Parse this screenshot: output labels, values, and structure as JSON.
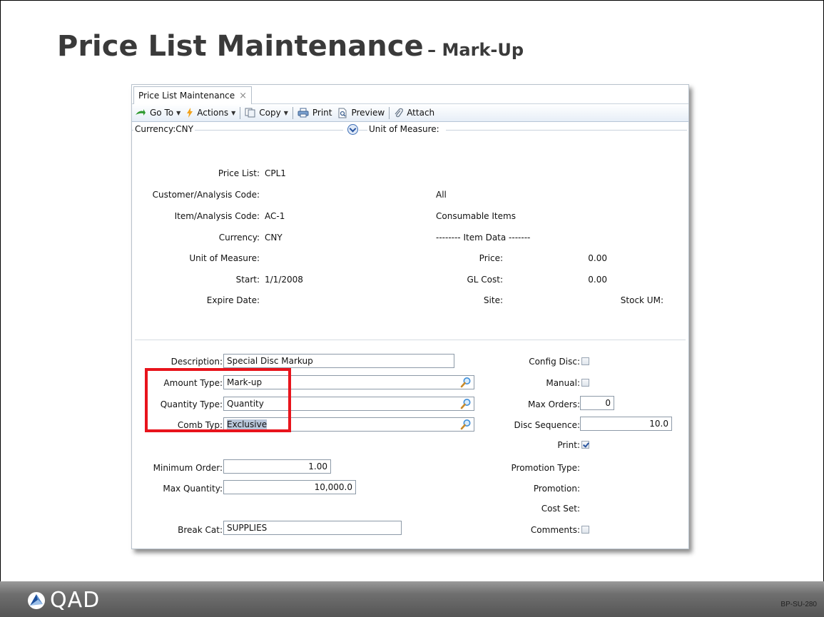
{
  "slide": {
    "title": "Price List Maintenance",
    "title_suffix": "– Mark-Up",
    "logo_text": "QAD",
    "code": "BP-SU-280"
  },
  "window": {
    "tab_label": "Price List Maintenance",
    "tab_close": "×",
    "toolbar": {
      "goto": "Go To",
      "actions": "Actions",
      "copy": "Copy",
      "print": "Print",
      "preview": "Preview",
      "attach": "Attach"
    },
    "filters": {
      "currency": "Currency:CNY",
      "uom": "Unit of Measure:"
    },
    "header": {
      "price_list_label": "Price List:",
      "price_list_value": "CPL1",
      "customer_label": "Customer/Analysis Code:",
      "customer_value": "All",
      "item_label": "Item/Analysis Code:",
      "item_value": "AC-1",
      "item_desc": "Consumable Items",
      "currency_label": "Currency:",
      "currency_value": "CNY",
      "item_data_heading": "-------- Item Data -------",
      "uom_label": "Unit of Measure:",
      "price_label": "Price:",
      "price_value": "0.00",
      "start_label": "Start:",
      "start_value": "1/1/2008",
      "gl_cost_label": "GL Cost:",
      "gl_cost_value": "0.00",
      "expire_label": "Expire Date:",
      "site_label": "Site:",
      "stock_um_label": "Stock UM:"
    },
    "form": {
      "description_label": "Description:",
      "description_value": "Special Disc Markup",
      "amount_type_label": "Amount Type:",
      "amount_type_value": "Mark-up",
      "quantity_type_label": "Quantity Type:",
      "quantity_type_value": "Quantity",
      "comb_typ_label": "Comb Typ:",
      "comb_typ_value": "Exclusive",
      "minimum_order_label": "Minimum Order:",
      "minimum_order_value": "1.00",
      "max_quantity_label": "Max Quantity:",
      "max_quantity_value": "10,000.0",
      "break_cat_label": "Break Cat:",
      "break_cat_value": "SUPPLIES",
      "config_disc_label": "Config Disc:",
      "manual_label": "Manual:",
      "max_orders_label": "Max Orders:",
      "max_orders_value": "0",
      "disc_sequence_label": "Disc Sequence:",
      "disc_sequence_value": "10.0",
      "print_label": "Print:",
      "promotion_type_label": "Promotion Type:",
      "promotion_label": "Promotion:",
      "cost_set_label": "Cost Set:",
      "comments_label": "Comments:",
      "config_disc_checked": false,
      "manual_checked": false,
      "print_checked": true,
      "comments_checked": false
    }
  },
  "colors": {
    "highlight": "#e8141c",
    "title_text": "#3a3a3a"
  }
}
